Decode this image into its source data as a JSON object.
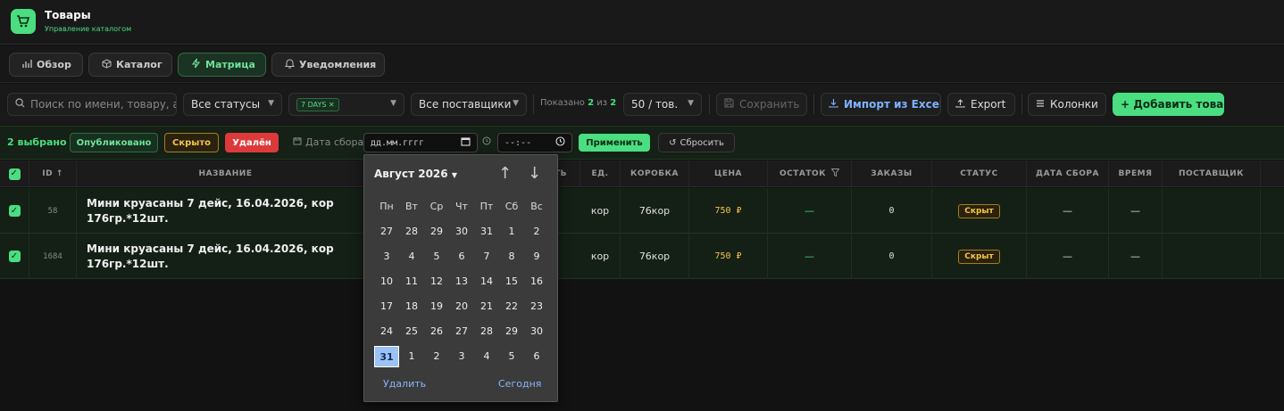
{
  "app": {
    "title": "Товары",
    "subtitle": "Управление каталогом",
    "icon": "cart-icon"
  },
  "nav": {
    "tabs": [
      {
        "label": "Обзор",
        "icon": "bar-chart-icon"
      },
      {
        "label": "Каталог",
        "icon": "box-icon"
      },
      {
        "label": "Матрица",
        "icon": "lightning-icon",
        "active": true
      },
      {
        "label": "Уведомления",
        "icon": "bell-icon"
      }
    ]
  },
  "toolbar": {
    "search_placeholder": "Поиск по имени, товару, а",
    "status_filter": "Все статусы",
    "days_chip": "7 DAYS",
    "supplier_filter": "Все поставщики",
    "shown_prefix": "Показано",
    "shown_count": "2",
    "shown_mid": "из",
    "shown_total": "2",
    "per_page": "50 / тов.",
    "save_label": "Сохранить",
    "import_label": "Импорт из Excel",
    "export_label": "Export",
    "columns_label": "Колонки",
    "add_label": "+ Добавить товар"
  },
  "selection": {
    "count_label": "2 выбрано",
    "published_label": "Опубликовано",
    "hidden_label": "Скрыто",
    "deleted_label": "Удалён",
    "date_label": "Дата сбора",
    "date_placeholder": "дд.мм.гггг",
    "time_placeholder": "--:--",
    "apply_label": "Применить",
    "reset_label": "Сбросить"
  },
  "table": {
    "headers": {
      "id": "ID ↑",
      "name": "НАЗВАНИЕ",
      "hidden_col": "ТЬ",
      "unit": "ЕД.",
      "box": "КОРОБКА",
      "price": "ЦЕНА",
      "stock": "ОСТАТОК",
      "orders": "ЗАКАЗЫ",
      "status": "СТАТУС",
      "date": "ДАТА СБОРА",
      "time": "ВРЕМЯ",
      "supplier": "ПОСТАВЩИК"
    },
    "rows": [
      {
        "id": "58",
        "name_line1": "Мини круасаны 7 дейс, 16.04.2026, кор",
        "name_line2": "176гр.*12шт.",
        "unit": "кор",
        "box": "76кор",
        "price": "750 ₽",
        "stock": "—",
        "orders": "0",
        "status": "Скрыт",
        "date": "—",
        "time": "—"
      },
      {
        "id": "1684",
        "name_line1": "Мини круасаны 7 дейс, 16.04.2026, кор",
        "name_line2": "176гр.*12шт.",
        "unit": "кор",
        "box": "76кор",
        "price": "750 ₽",
        "stock": "—",
        "orders": "0",
        "status": "Скрыт",
        "date": "—",
        "time": "—"
      }
    ]
  },
  "datepicker": {
    "month": "Август 2026",
    "weekdays": [
      "Пн",
      "Вт",
      "Ср",
      "Чт",
      "Пт",
      "Сб",
      "Вс"
    ],
    "weeks": [
      [
        "27",
        "28",
        "29",
        "30",
        "31",
        "1",
        "2"
      ],
      [
        "3",
        "4",
        "5",
        "6",
        "7",
        "8",
        "9"
      ],
      [
        "10",
        "11",
        "12",
        "13",
        "14",
        "15",
        "16"
      ],
      [
        "17",
        "18",
        "19",
        "20",
        "21",
        "22",
        "23"
      ],
      [
        "24",
        "25",
        "26",
        "27",
        "28",
        "29",
        "30"
      ],
      [
        "31",
        "1",
        "2",
        "3",
        "4",
        "5",
        "6"
      ]
    ],
    "selected_week": 5,
    "selected_index": 0,
    "clear_label": "Удалить",
    "today_label": "Сегодня"
  }
}
